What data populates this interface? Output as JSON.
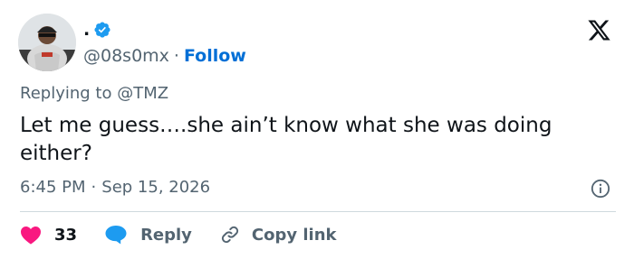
{
  "author": {
    "display_name": ".",
    "handle": "@08s0mx",
    "separator": "·",
    "follow_label": "Follow",
    "verified_color": "#1d9bf0"
  },
  "reply_context": {
    "prefix": "Replying to",
    "target": "@TMZ"
  },
  "tweet": {
    "text": "Let me guess….she ain’t know what she was doing either?",
    "time": "6:45 PM",
    "separator": "·",
    "date": "Sep 15, 2026"
  },
  "actions": {
    "like_count": "33",
    "reply_label": "Reply",
    "copy_label": "Copy link"
  },
  "colors": {
    "like": "#f91880",
    "reply": "#1d9bf0",
    "muted": "#536471",
    "link": "#006fd6"
  },
  "icons": {
    "logo": "x-logo-icon",
    "verified": "verified-badge-icon",
    "info": "info-icon",
    "like": "heart-icon",
    "reply": "speech-bubble-icon",
    "copy": "link-icon"
  }
}
